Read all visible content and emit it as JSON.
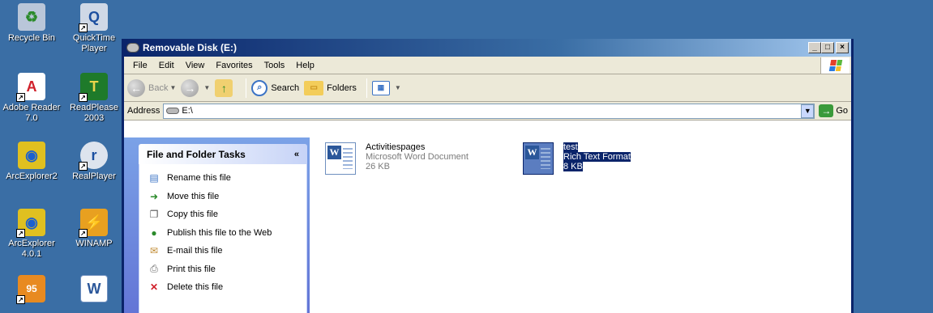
{
  "desktop": {
    "icons": [
      {
        "label": "Recycle Bin",
        "icon": "recycle-bin-icon"
      },
      {
        "label": "QuickTime Player",
        "icon": "quicktime-icon"
      },
      {
        "label": "Adobe Reader 7.0",
        "icon": "adobe-reader-icon"
      },
      {
        "label": "ReadPlease 2003",
        "icon": "readplease-icon"
      },
      {
        "label": "ArcExplorer2",
        "icon": "arcexplorer-icon"
      },
      {
        "label": "RealPlayer",
        "icon": "realplayer-icon"
      },
      {
        "label": "ArcExplorer 4.0.1",
        "icon": "arcexplorer-icon"
      },
      {
        "label": "WINAMP",
        "icon": "winamp-icon"
      }
    ]
  },
  "window": {
    "title": "Removable Disk (E:)",
    "buttons": {
      "minimize": "_",
      "maximize": "□",
      "close": "×"
    }
  },
  "menu": [
    "File",
    "Edit",
    "View",
    "Favorites",
    "Tools",
    "Help"
  ],
  "toolbar": {
    "back": "Back",
    "search": "Search",
    "folders": "Folders"
  },
  "address": {
    "label": "Address",
    "value": "E:\\",
    "go": "Go"
  },
  "tasks": {
    "title": "File and Folder Tasks",
    "items": [
      {
        "label": "Rename this file",
        "icon": "rename-icon"
      },
      {
        "label": "Move this file",
        "icon": "move-icon"
      },
      {
        "label": "Copy this file",
        "icon": "copy-icon"
      },
      {
        "label": "Publish this file to the Web",
        "icon": "publish-web-icon"
      },
      {
        "label": "E-mail this file",
        "icon": "email-icon"
      },
      {
        "label": "Print this file",
        "icon": "print-icon"
      },
      {
        "label": "Delete this file",
        "icon": "delete-icon"
      }
    ]
  },
  "files": [
    {
      "name": "Activitiespages",
      "type": "Microsoft Word Document",
      "size": "26 KB",
      "selected": false
    },
    {
      "name": "test",
      "type": "Rich Text Format",
      "size": "8 KB",
      "selected": true
    }
  ],
  "colors": {
    "desktop": "#3a6ea5",
    "title_bar": "#0a246a",
    "task_pane": "#7ba2e7",
    "selection": "#0a246a"
  }
}
